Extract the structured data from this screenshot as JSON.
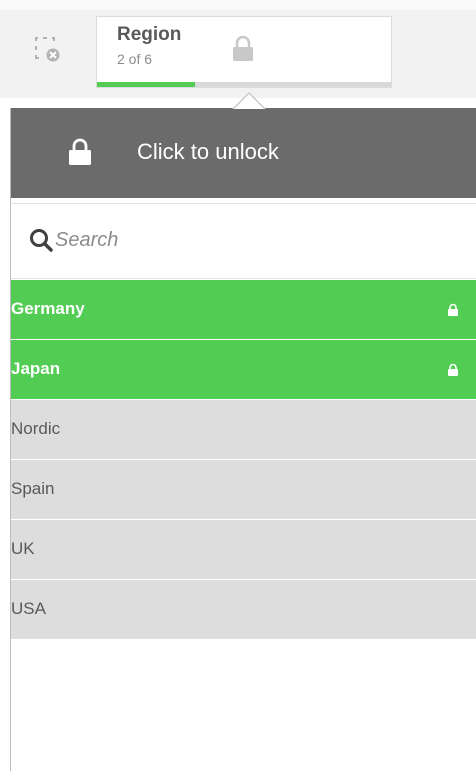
{
  "selection_bar": {
    "clear_icon": "clear-selections-icon",
    "field": {
      "title": "Region",
      "count": "2 of 6",
      "lock_icon": "lock-icon",
      "selected_fraction": 0.333
    }
  },
  "popover": {
    "unlock_label": "Click to unlock",
    "unlock_icon": "lock-icon",
    "search": {
      "placeholder": "Search",
      "value": "",
      "icon": "search-icon"
    },
    "items": [
      {
        "label": "Germany",
        "state": "selected",
        "locked": true
      },
      {
        "label": "Japan",
        "state": "selected",
        "locked": true
      },
      {
        "label": "Nordic",
        "state": "alternative",
        "locked": false
      },
      {
        "label": "Spain",
        "state": "alternative",
        "locked": false
      },
      {
        "label": "UK",
        "state": "alternative",
        "locked": false
      },
      {
        "label": "USA",
        "state": "alternative",
        "locked": false
      }
    ]
  },
  "colors": {
    "selected": "#52cc52",
    "alternative": "#dddddd",
    "unlock_bar": "#6b6b6b"
  }
}
